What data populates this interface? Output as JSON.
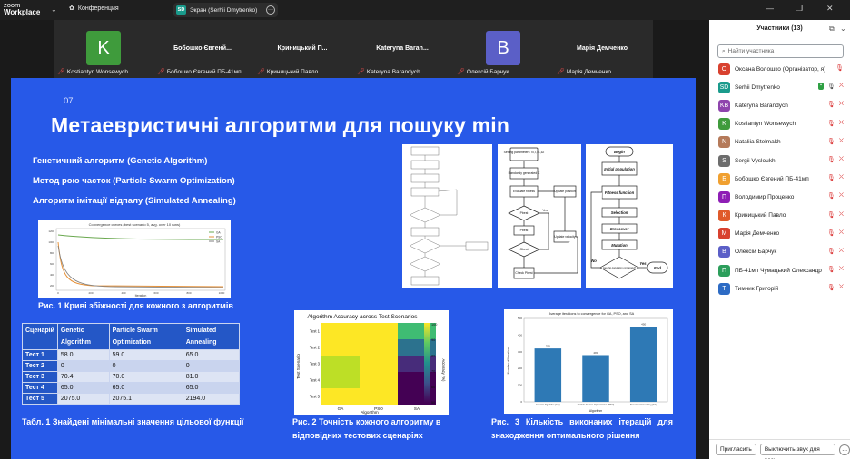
{
  "app": {
    "logo_line1": "zoom",
    "logo_line2": "Workplace",
    "meeting_label": "Конференция",
    "share_label": "Экран (Serhii Dmytrenko)",
    "share_badge": "SD"
  },
  "strip": [
    {
      "name": "",
      "caption": "Kostiantyn Wonsewych",
      "avatar": "K",
      "avatar_color": "#3f9b3c"
    },
    {
      "name": "Бобошко Євгенй...",
      "caption": "Бобошко Євгений ПБ-41мп",
      "avatar": "",
      "avatar_color": ""
    },
    {
      "name": "Криницький П...",
      "caption": "Криницький Павло",
      "avatar": "",
      "avatar_color": ""
    },
    {
      "name": "Kateryna Baran...",
      "caption": "Kateryna Barandych",
      "avatar": "",
      "avatar_color": ""
    },
    {
      "name": "",
      "caption": "Олексій Барчук",
      "avatar": "В",
      "avatar_color": "#5b5fc7"
    },
    {
      "name": "Марія Демченко",
      "caption": "Марія Демченко",
      "avatar": "",
      "avatar_color": ""
    }
  ],
  "slide": {
    "number": "07",
    "title": "Метаевристичні алгоритми для пошуку min",
    "bullets": [
      "Генетичний алгоритм (Genetic Algorithm)",
      "Метод рою часток (Particle Swarm Optimization)",
      "Алгоритм імітації відпалу (Simulated Annealing)"
    ],
    "fig1_caption": "Рис. 1 Криві збіжності для кожного з алгоритмів",
    "fig1_title": "Convergence curves (best scenario 5, avg. over 10 runs)",
    "fig1_xlabel": "Iteration",
    "fig1_legend": [
      "GA",
      "PSO",
      "SA"
    ],
    "table": {
      "headers": [
        "Сценарій",
        "Genetic Algorithm",
        "Particle Swarm Optimization",
        "Simulated Annealing"
      ],
      "rows": [
        [
          "Тест 1",
          "58.0",
          "59.0",
          "65.0"
        ],
        [
          "Тест 2",
          "0",
          "0",
          "0"
        ],
        [
          "Тест 3",
          "70.4",
          "70.0",
          "81.0"
        ],
        [
          "Тест 4",
          "65.0",
          "65.0",
          "65.0"
        ],
        [
          "Тест 5",
          "2075.0",
          "2075.1",
          "2194.0"
        ]
      ]
    },
    "table_caption": "Табл. 1 Знайдені мінімальні значення цільової функції",
    "fig2_caption": "Рис. 2 Точність кожного алгоритму в відповідних тестових сценаріях",
    "fig3_caption": "Рис. 3 Кількість виконаних ітерацій для знаходження оптимального рішення",
    "flow3": {
      "start": "Begin",
      "n1": "Initial population",
      "n2": "Fitness function",
      "n3": "Selection",
      "n4": "Crossover",
      "n5": "Mutation",
      "n6": "Has the population converged?",
      "yes": "Yes",
      "no": "No",
      "end": "End"
    },
    "flow2": {
      "n1": "Setting parameters: N,T,c1,c2",
      "n2": "Randomly generated X",
      "n3": "Evaluate fitness",
      "n4": "Update position",
      "n5": "Update velocity",
      "n6": "Pbest",
      "n7": "Gbest",
      "n8": "Check Pbest",
      "yes": "Yes",
      "no": "No"
    }
  },
  "heatmap": {
    "title": "Algorithm Accuracy across Test Scenarios",
    "xlabel": "Algorithm",
    "ylabel": "Test Scenario",
    "cbar_label": "Accuracy (%)",
    "x": [
      "GA",
      "PSO",
      "SA"
    ],
    "y": [
      "Test 1",
      "Test 2",
      "Test 3",
      "Test 4",
      "Test 5"
    ],
    "cbar_ticks": [
      "100",
      "90",
      "80",
      "70",
      "60",
      "50"
    ]
  },
  "chart_data": {
    "type": "bar",
    "title": "Average iterations to convergence for GA, PSO, and SA",
    "categories": [
      "Genetic Algorithm (GA)",
      "Particle Swarm Optimization (PSO)",
      "Simulated Annealing (SA)"
    ],
    "values": [
      320,
      280,
      450
    ],
    "value_labels": [
      "320",
      "280",
      "450"
    ],
    "ylabel": "Number of Iterations",
    "xlabel": "Algorithm",
    "ylim": [
      0,
      500
    ],
    "yticks": [
      "0",
      "100",
      "200",
      "300",
      "400",
      "500"
    ],
    "color": "#2e79b5"
  },
  "convergence_chart": {
    "type": "line",
    "yticks": [
      "1200",
      "1000",
      "800",
      "600",
      "400",
      "200"
    ],
    "xticks": [
      "0",
      "200",
      "400",
      "600",
      "800",
      "1000"
    ],
    "colors": [
      "#6aa84f",
      "#e69138",
      "#7f7f7f"
    ]
  },
  "sidebar": {
    "title": "Участники (13)",
    "search_placeholder": "Найти участника",
    "participants": [
      {
        "name": "Оксана Волошко (Організатор, я)",
        "initials": "О",
        "color": "#d8412f",
        "mic": "muted"
      },
      {
        "name": "Serhii Dmytrenko",
        "initials": "SD",
        "color": "#1a9b8c",
        "mic": "on"
      },
      {
        "name": "Kateryna Barandych",
        "initials": "KB",
        "color": "#8e44ad",
        "mic": "muted"
      },
      {
        "name": "Kostiantyn Wonsewych",
        "initials": "K",
        "color": "#3f9b3c",
        "mic": "muted"
      },
      {
        "name": "Nataliia Stelmakh",
        "initials": "N",
        "color": "#b57a5a",
        "mic": "muted"
      },
      {
        "name": "Sergii Vysloukh",
        "initials": "S",
        "color": "#6d6d6d",
        "mic": "muted"
      },
      {
        "name": "Бобошко Євгений ПБ-41мп",
        "initials": "Б",
        "color": "#f0a030",
        "mic": "muted"
      },
      {
        "name": "Володимир Проценко",
        "initials": "П",
        "color": "#8e1eb5",
        "mic": "muted"
      },
      {
        "name": "Криницький Павло",
        "initials": "К",
        "color": "#e05a2a",
        "mic": "muted"
      },
      {
        "name": "Марія Демченко",
        "initials": "М",
        "color": "#d8412f",
        "mic": "muted"
      },
      {
        "name": "Олексій Барчук",
        "initials": "В",
        "color": "#5b5fc7",
        "mic": "muted"
      },
      {
        "name": "ПБ-41мп Чумацький Олександр",
        "initials": "П",
        "color": "#2c9e5b",
        "mic": "muted"
      },
      {
        "name": "Тимчик Григорій",
        "initials": "Т",
        "color": "#2d6bc4",
        "mic": "muted"
      }
    ],
    "invite_label": "Пригласить",
    "mute_all_label": "Выключить звук для всех",
    "more_label": "..."
  }
}
